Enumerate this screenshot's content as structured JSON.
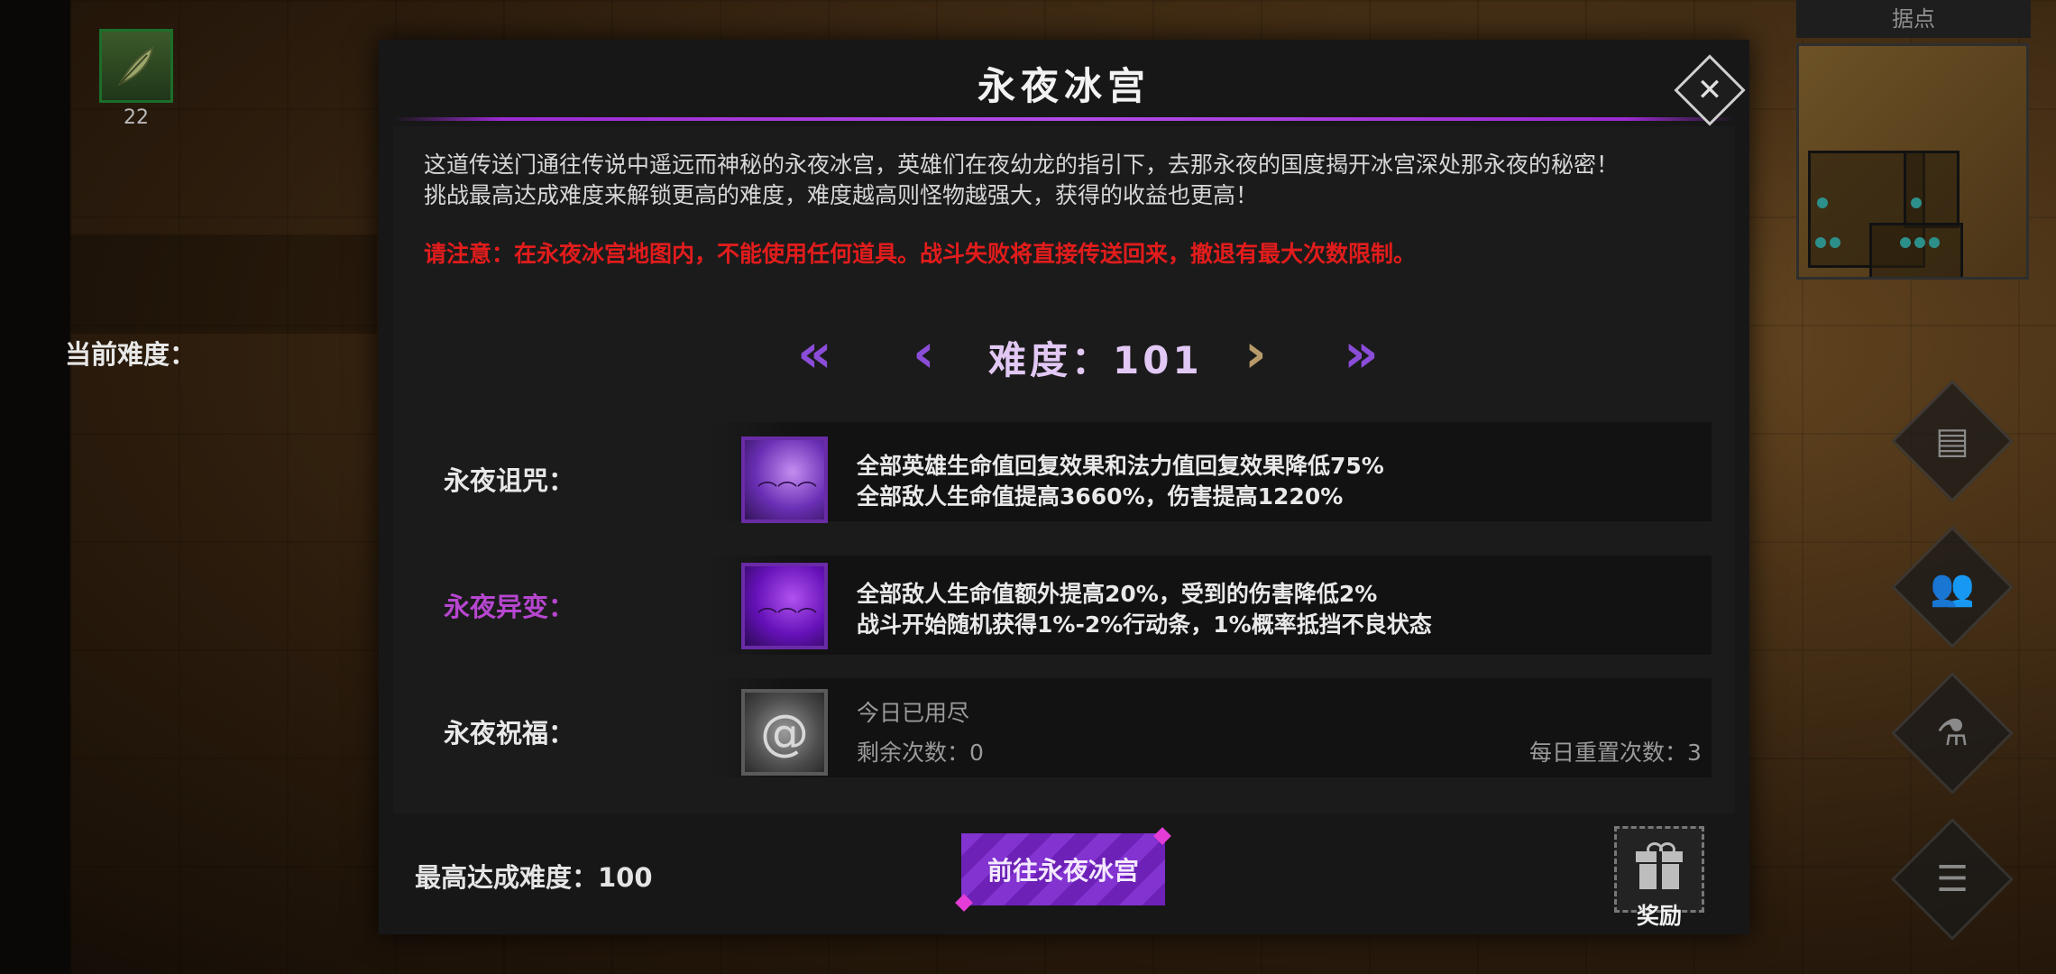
{
  "hud": {
    "item_count": "22",
    "minimap_title": "据点"
  },
  "dialog": {
    "title": "永夜冰宫",
    "close": "✕",
    "description_lines": [
      "这道传送门通往传说中遥远而神秘的永夜冰宫，英雄们在夜幼龙的指引下，去那永夜的国度揭开冰宫深处那永夜的秘密！",
      "挑战最高达成难度来解锁更高的难度，难度越高则怪物越强大，获得的收益也更高！"
    ],
    "warning": "请注意：在永夜冰宫地图内，不能使用任何道具。战斗失败将直接传送回来，撤退有最大次数限制。",
    "difficulty": {
      "label": "当前难度：",
      "value": "难度：101",
      "first": "«",
      "prev": "‹",
      "next": "›",
      "last": "»"
    },
    "curse": {
      "label": "永夜诅咒：",
      "lines": [
        "全部英雄生命值回复效果和法力值回复效果降低75%",
        "全部敌人生命值提高3660%，伤害提高1220%"
      ]
    },
    "mutation": {
      "label": "永夜异变：",
      "lines": [
        "全部敌人生命值额外提高20%，受到的伤害降低2%",
        "战斗开始随机获得1%-2%行动条，1%概率抵挡不良状态"
      ]
    },
    "blessing": {
      "label": "永夜祝福：",
      "status": "今日已用尽",
      "remaining": "剩余次数：0",
      "daily_reset": "每日重置次数：3"
    },
    "best": "最高达成难度：100",
    "go_button": "前往永夜冰宫",
    "reward_label": "奖励"
  },
  "colors": {
    "accent_purple": "#8a4dd8",
    "warning_red": "#e21c1c",
    "mutation_label": "#b646cf"
  }
}
